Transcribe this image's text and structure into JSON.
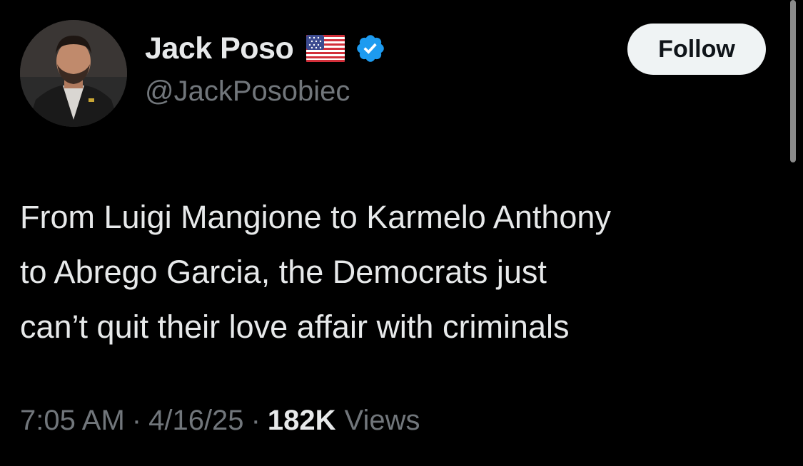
{
  "author": {
    "display_name": "Jack Poso",
    "flag_icon": "us-flag-icon",
    "verified_icon": "verified-badge-icon",
    "handle": "@JackPosobiec",
    "avatar_icon": "avatar"
  },
  "follow_button": {
    "label": "Follow"
  },
  "tweet": {
    "text_lines": [
      "From Luigi Mangione to Karmelo Anthony",
      "to Abrego Garcia, the Democrats just",
      "can’t quit their love affair with criminals"
    ]
  },
  "meta": {
    "time": "7:05 AM",
    "separator": "·",
    "date": "4/16/25",
    "views_count": "182K",
    "views_label": "Views"
  },
  "colors": {
    "background": "#000000",
    "primary_text": "#e7e9ea",
    "secondary_text": "#71767b",
    "verified_blue": "#1d9bf0",
    "follow_bg": "#eff3f4"
  }
}
